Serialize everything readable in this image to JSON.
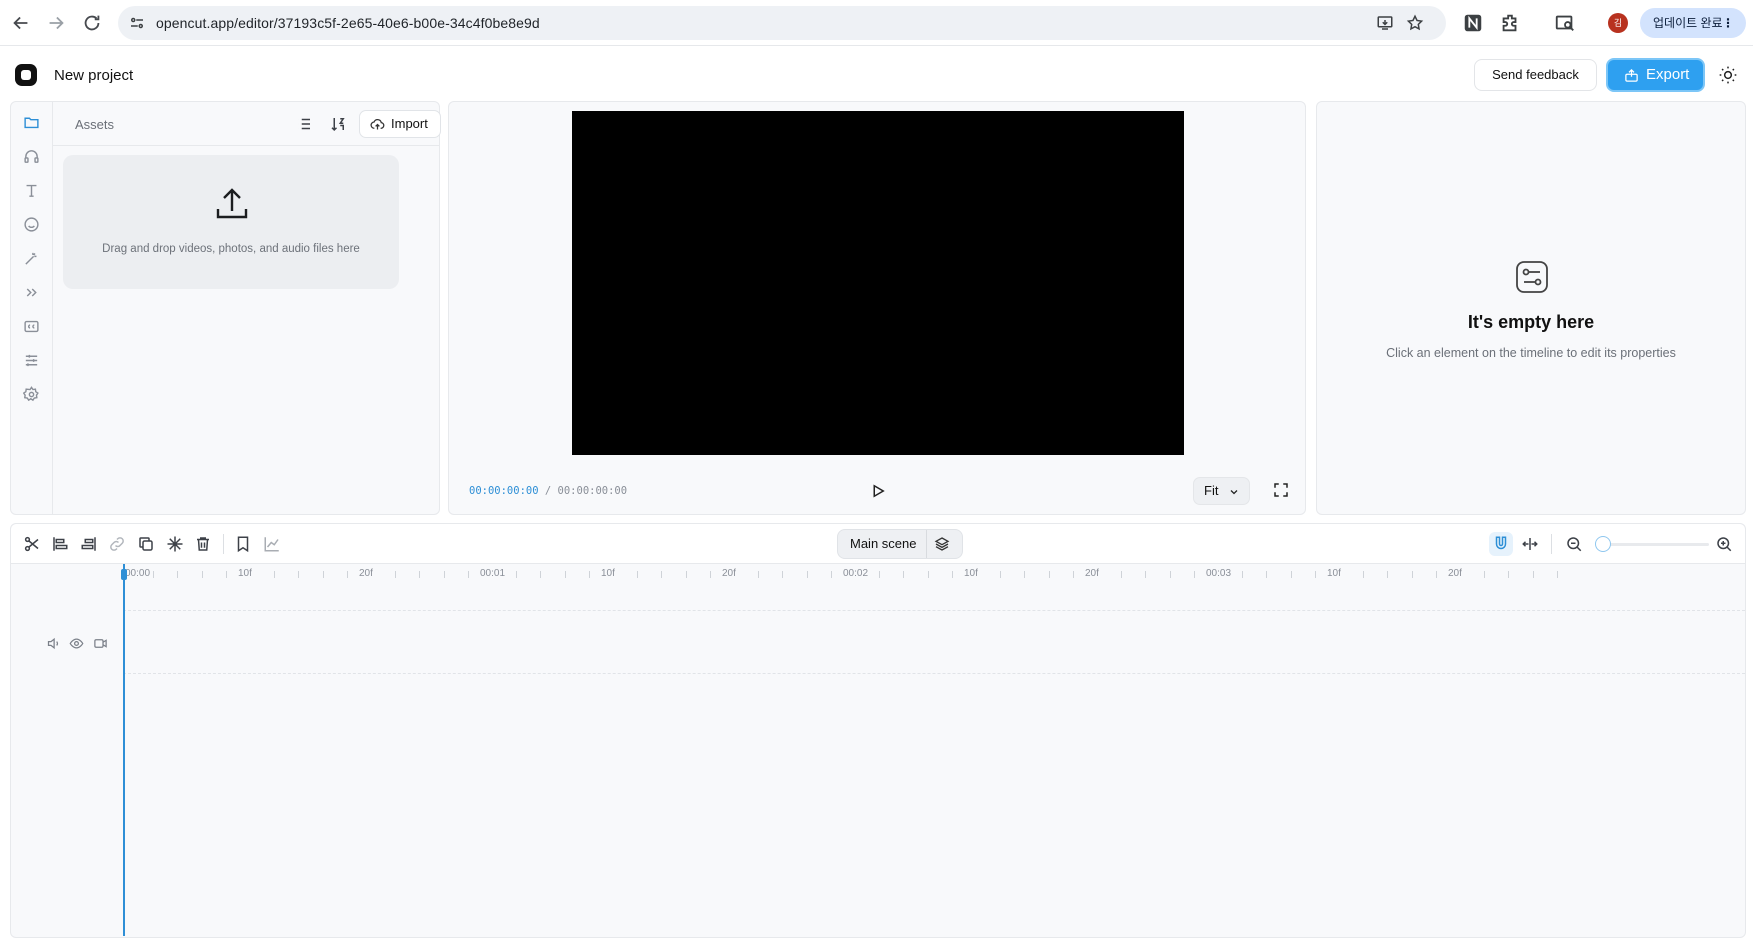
{
  "browser": {
    "url": "opencut.app/editor/37193c5f-2e65-40e6-b00e-34c4f0be8e9d",
    "profile_initial": "김",
    "update_label": "업데이트 완료",
    "update_menu": "⋮"
  },
  "header": {
    "project_name": "New project",
    "feedback_label": "Send feedback",
    "export_label": "Export"
  },
  "sidebar": {
    "items": [
      {
        "icon": "folder-icon",
        "active": true
      },
      {
        "icon": "headphones-icon"
      },
      {
        "icon": "text-icon"
      },
      {
        "icon": "sticker-icon"
      },
      {
        "icon": "magic-wand-icon"
      },
      {
        "icon": "transitions-icon"
      },
      {
        "icon": "captions-icon"
      },
      {
        "icon": "adjustments-icon"
      },
      {
        "icon": "settings-icon"
      }
    ]
  },
  "assets": {
    "title": "Assets",
    "import_label": "Import",
    "drop_hint": "Drag and drop videos, photos, and audio files here"
  },
  "preview": {
    "current_time": "00:00:00:00",
    "separator": "/",
    "total_time": "00:00:00:00",
    "fit_label": "Fit"
  },
  "properties": {
    "empty_title": "It's empty here",
    "empty_subtitle": "Click an element on the timeline to edit its properties"
  },
  "timeline": {
    "scene_label": "Main scene",
    "ruler_labels": [
      "00:00",
      "10f",
      "20f",
      "00:01",
      "10f",
      "20f",
      "00:02",
      "10f",
      "20f",
      "00:03",
      "10f",
      "20f"
    ]
  },
  "colors": {
    "accent": "#2e8fd6",
    "export_bg": "#2ea0f0",
    "preview_bg": "#000000",
    "panel_bg": "#f8f9fb"
  }
}
